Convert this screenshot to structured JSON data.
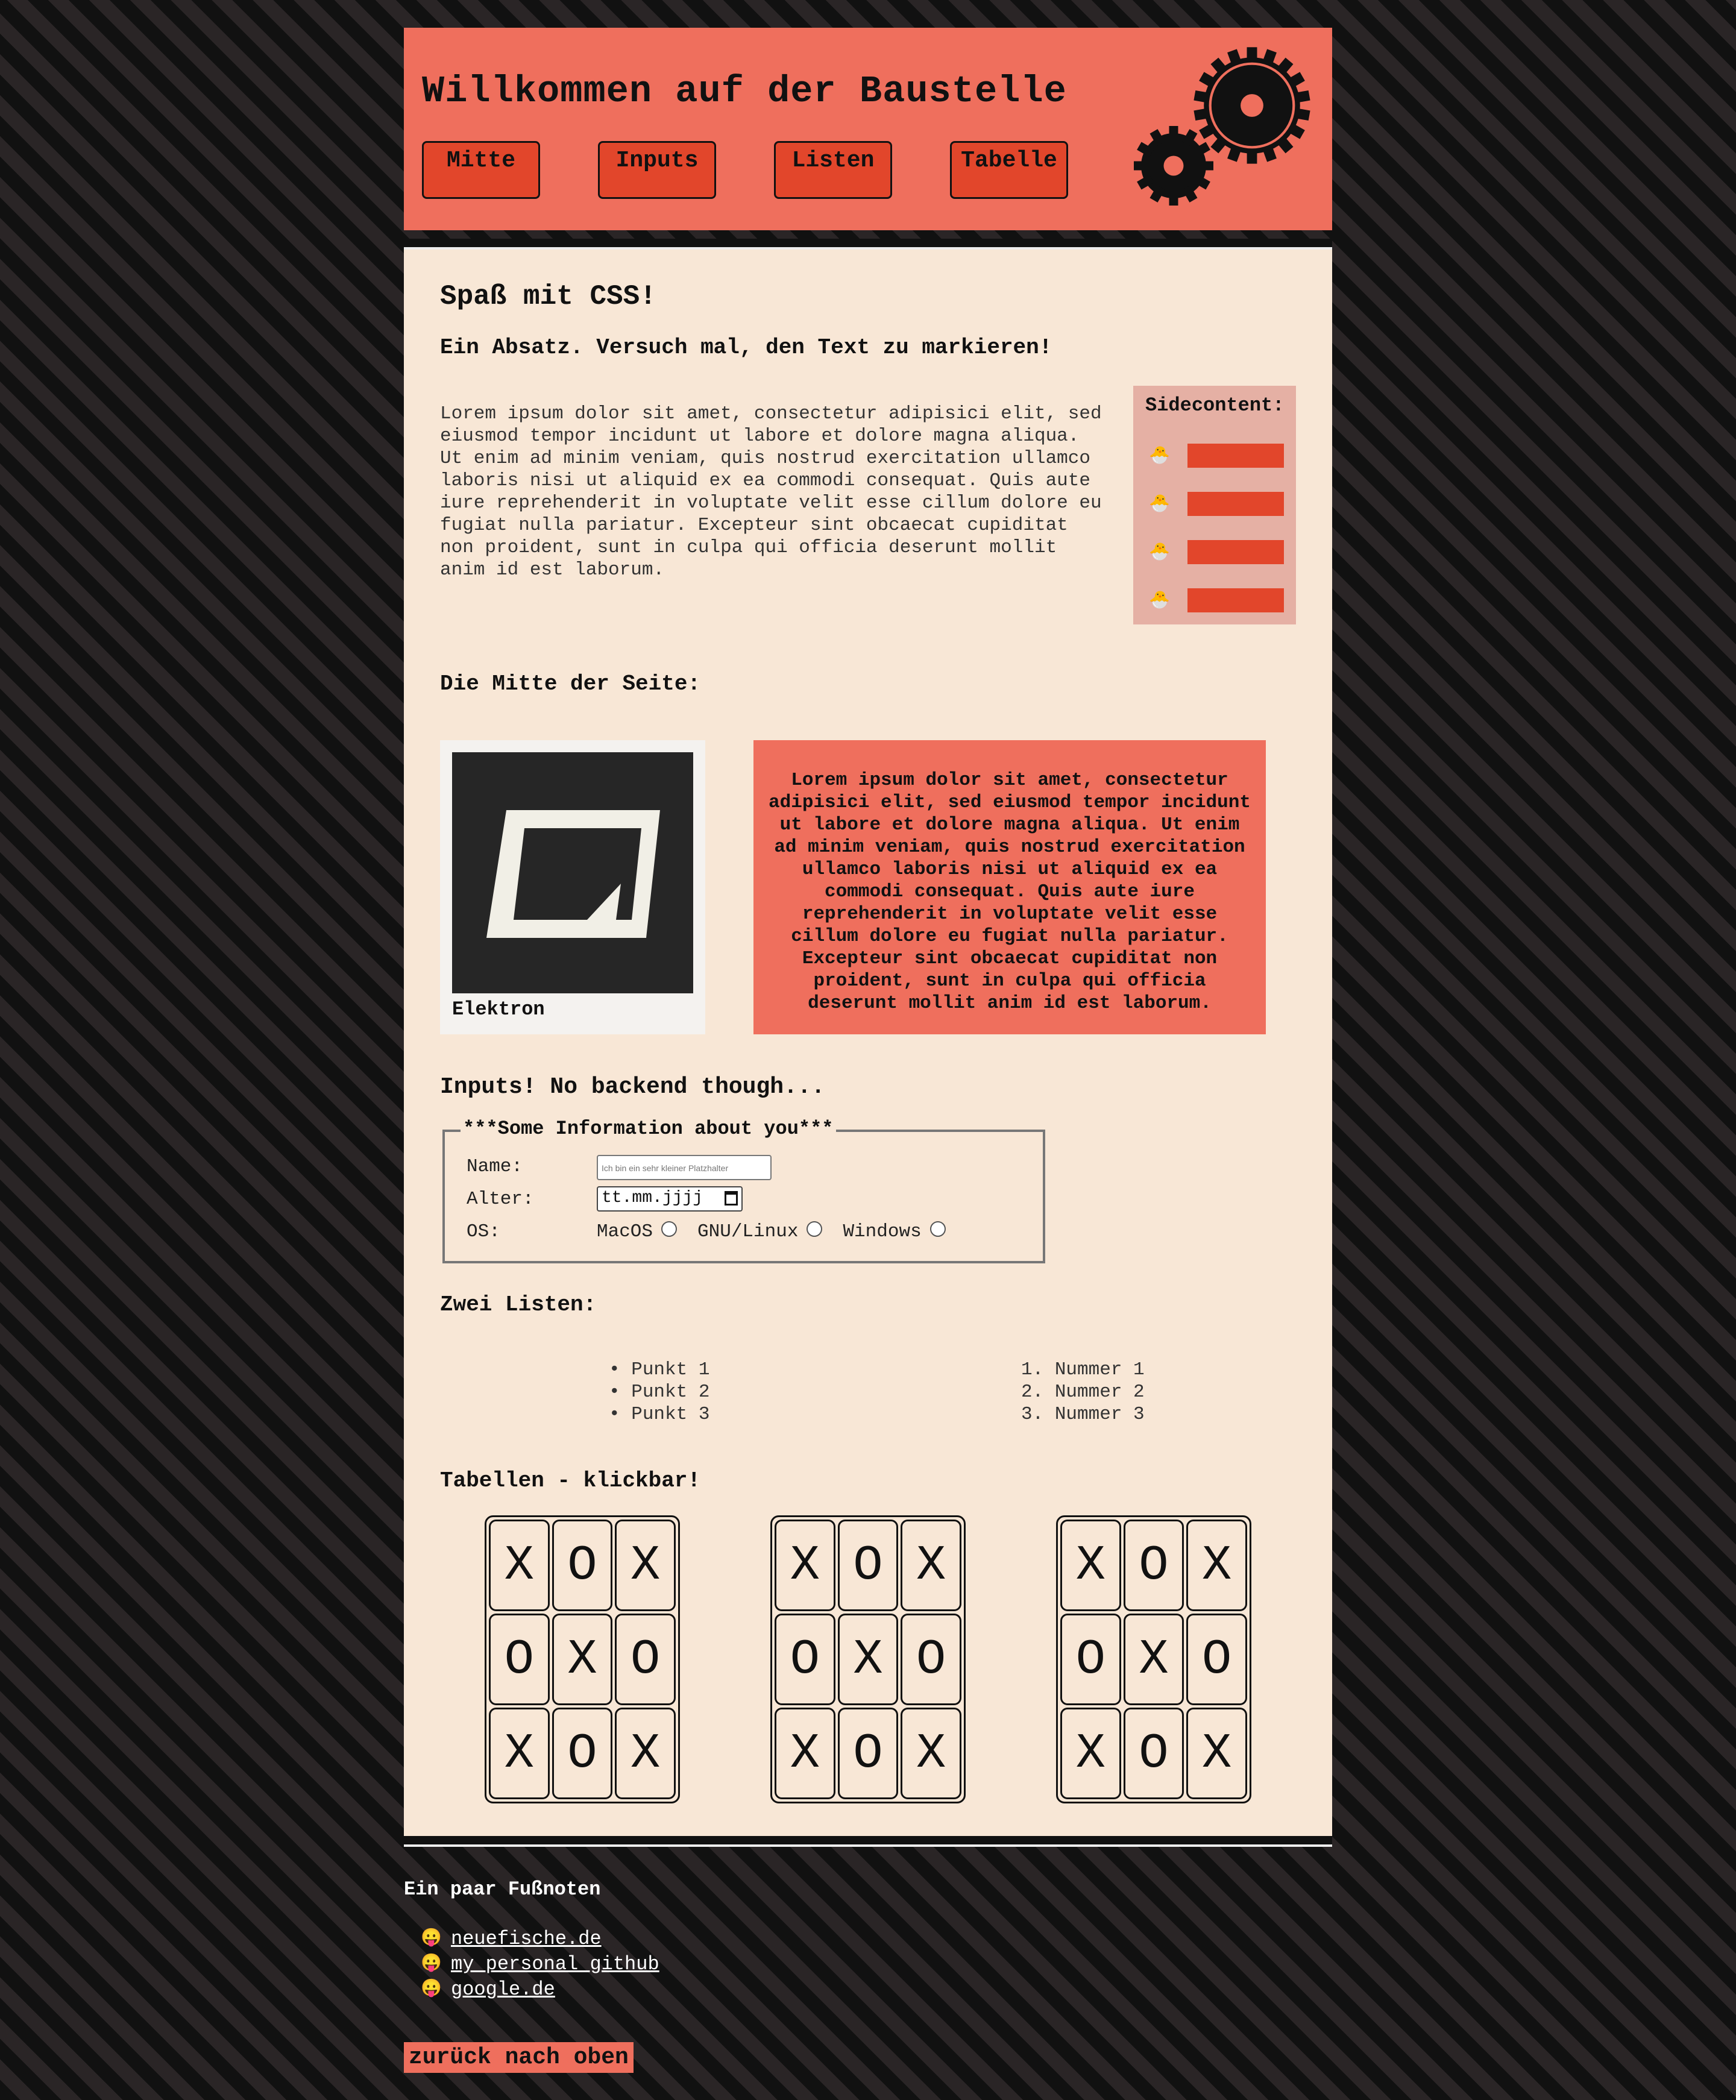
{
  "header": {
    "title": "Willkommen auf der Baustelle",
    "nav": [
      "Mitte",
      "Inputs",
      "Listen",
      "Tabelle"
    ]
  },
  "main": {
    "title": "Spaß mit CSS!",
    "subtitle": "Ein Absatz. Versuch mal, den Text zu markieren!",
    "paragraph": "Lorem ipsum dolor sit amet, consectetur adipisici elit, sed eiusmod tempor incidunt ut labore et dolore magna aliqua. Ut enim ad minim veniam, quis nostrud exercitation ullamco laboris nisi ut aliquid ex ea commodi consequat. Quis aute iure reprehenderit in voluptate velit esse cillum dolore eu fugiat nulla pariatur. Excepteur sint obcaecat cupiditat non proident, sunt in culpa qui officia deserunt mollit anim id est laborum.",
    "sidecontent": {
      "title": "Sidecontent:",
      "icon": "🐣",
      "item_color": "#e2462b",
      "item_count": 4
    },
    "mitte": {
      "title": "Die Mitte der Seite:",
      "image_caption": "Elektron",
      "box_text": "Lorem ipsum dolor sit amet, consectetur adipisici elit, sed eiusmod tempor incidunt ut labore et dolore magna aliqua. Ut enim ad minim veniam, quis nostrud exercitation ullamco laboris nisi ut aliquid ex ea commodi consequat. Quis aute iure reprehenderit in voluptate velit esse cillum dolore eu fugiat nulla pariatur. Excepteur sint obcaecat cupiditat non proident, sunt in culpa qui officia deserunt mollit anim id est laborum."
    },
    "inputs": {
      "title": "Inputs! No backend though...",
      "legend": "***Some Information about you***",
      "name_label": "Name:",
      "name_placeholder": "Ich bin ein sehr kleiner Platzhalter",
      "age_label": "Alter:",
      "age_value": "tt.mm.jjjj",
      "os_label": "OS:",
      "os_options": [
        "MacOS",
        "GNU/Linux",
        "Windows"
      ]
    },
    "lists": {
      "title": "Zwei Listen:",
      "unordered": [
        "Punkt 1",
        "Punkt 2",
        "Punkt 3"
      ],
      "ordered": [
        "Nummer 1",
        "Nummer 2",
        "Nummer 3"
      ]
    },
    "tables": {
      "title": "Tabellen - klickbar!",
      "boards": [
        [
          [
            "X",
            "O",
            "X"
          ],
          [
            "O",
            "X",
            "O"
          ],
          [
            "X",
            "O",
            "X"
          ]
        ],
        [
          [
            "X",
            "O",
            "X"
          ],
          [
            "O",
            "X",
            "O"
          ],
          [
            "X",
            "O",
            "X"
          ]
        ],
        [
          [
            "X",
            "O",
            "X"
          ],
          [
            "O",
            "X",
            "O"
          ],
          [
            "X",
            "O",
            "X"
          ]
        ]
      ]
    }
  },
  "footer": {
    "title": "Ein paar Fußnoten",
    "icon": "😛",
    "links": [
      "neuefische.de",
      "my personal github",
      "google.de"
    ],
    "top_button": "zurück nach oben"
  },
  "colors": {
    "accent": "#ef6f5d",
    "accent_dark": "#e2462b",
    "page_bg": "#f8e7d6"
  }
}
